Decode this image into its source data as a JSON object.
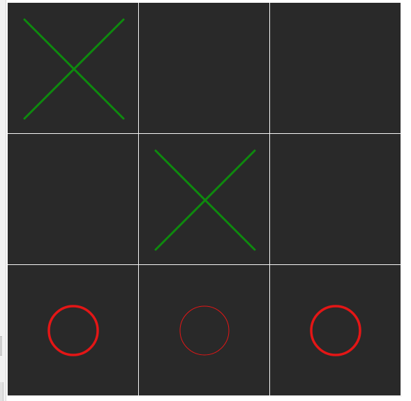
{
  "colors": {
    "x_mark": "#0e8a0e",
    "o_mark": "#e31616",
    "cell_background": "#292929",
    "grid_line": "#f7f7f7"
  },
  "board": {
    "rows": 3,
    "cols": 3,
    "cells": [
      [
        "X",
        "",
        ""
      ],
      [
        "",
        "X",
        ""
      ],
      [
        "O",
        "O",
        "O"
      ]
    ],
    "emphasis": [
      [
        "normal",
        "normal",
        "normal"
      ],
      [
        "normal",
        "normal",
        "normal"
      ],
      [
        "bold",
        "thin",
        "bold"
      ]
    ]
  }
}
